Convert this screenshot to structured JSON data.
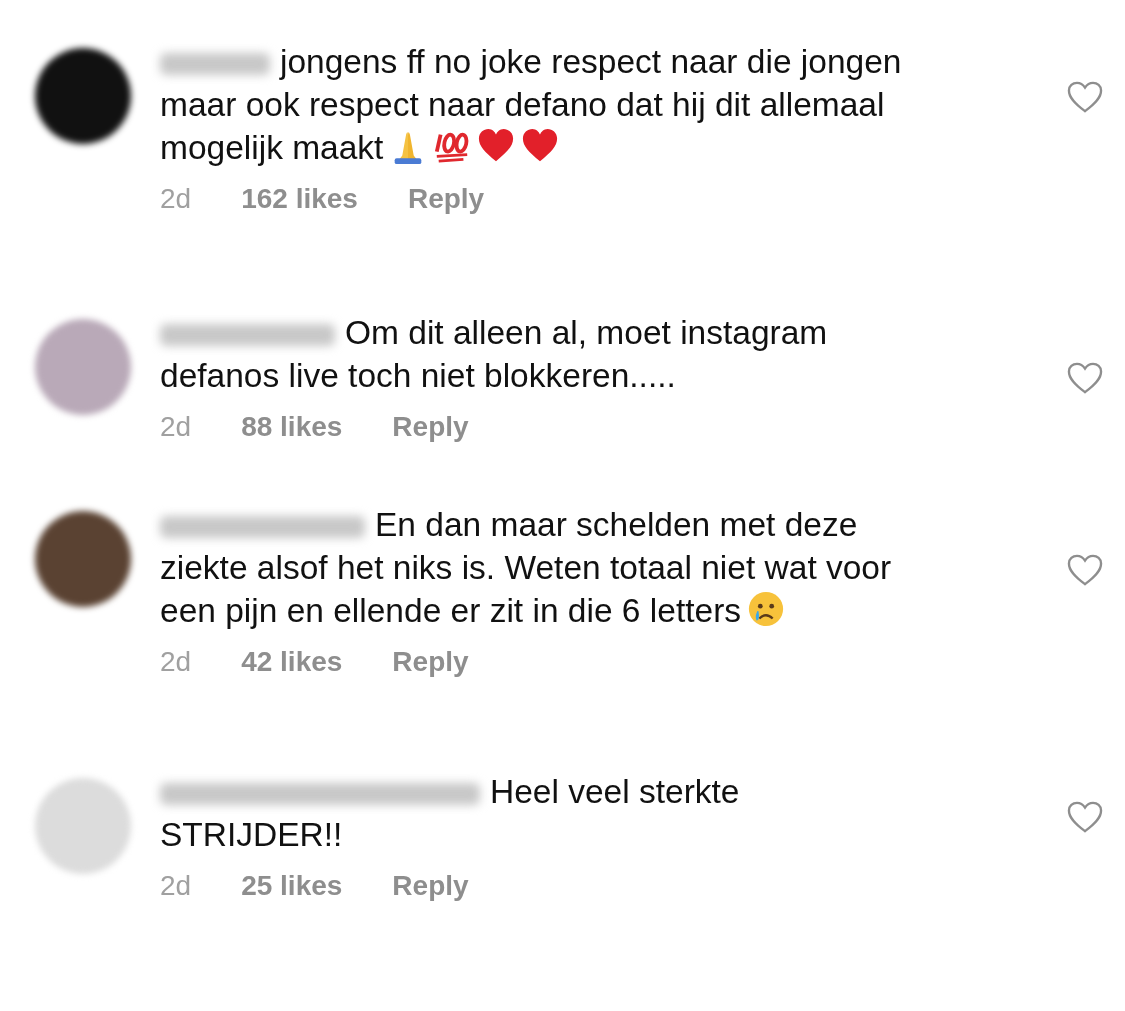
{
  "comments": [
    {
      "color": "#111111",
      "text": "jongens ff no joke respect naar die jongen maar ook respect naar defano dat hij dit allemaal mogelijk maakt",
      "emoji": [
        {
          "kind": "pray"
        },
        {
          "kind": "hundred"
        },
        {
          "kind": "heart"
        },
        {
          "kind": "heart"
        }
      ],
      "age": "2d",
      "likes": "162 likes",
      "reply": "Reply",
      "liked": false
    },
    {
      "color": "#b9a9b8",
      "text": "Om dit alleen al, moet instagram defanos live toch niet blokkeren.....",
      "age": "2d",
      "likes": "88 likes",
      "reply": "Reply",
      "liked": false
    },
    {
      "color": "#5a4232",
      "text": "En dan maar schelden met deze ziekte alsof het niks is. Weten totaal niet wat voor een pijn en ellende er zit in die 6 letters",
      "emoji": [
        {
          "kind": "crying"
        }
      ],
      "age": "2d",
      "likes": "42 likes",
      "reply": "Reply",
      "liked": false
    },
    {
      "color": "#dcdcdc",
      "text": "Heel veel sterkte STRIJDER!!",
      "age": "2d",
      "likes": "25 likes",
      "reply": "Reply",
      "liked": false
    }
  ]
}
